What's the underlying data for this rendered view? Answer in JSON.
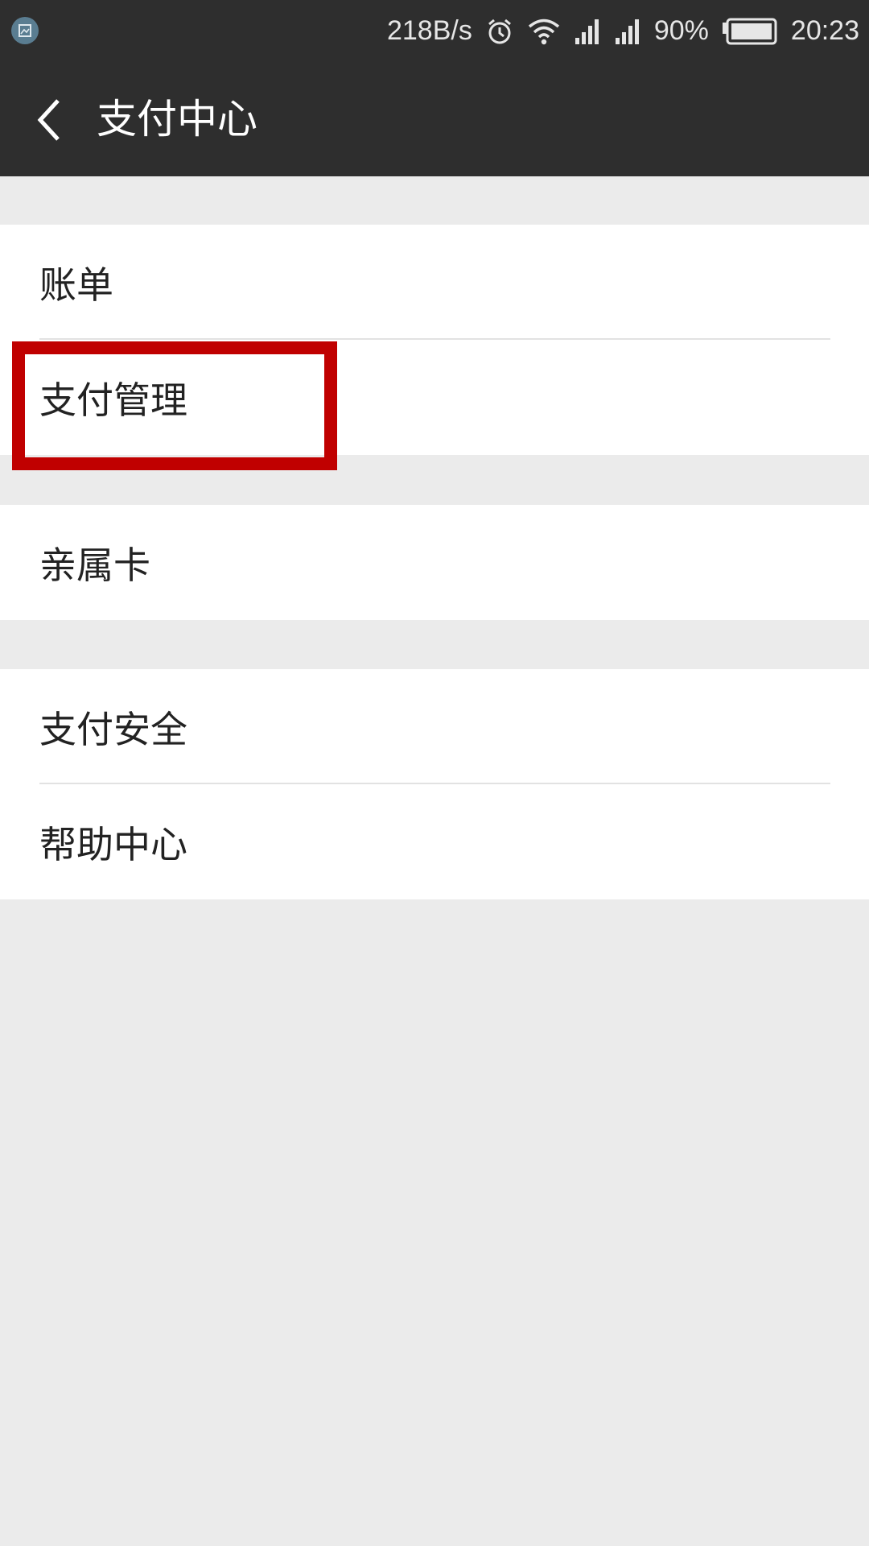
{
  "status_bar": {
    "net_speed": "218B/s",
    "battery_percent": "90%",
    "time": "20:23",
    "icons": [
      "screenshot-icon",
      "alarm-icon",
      "wifi-icon",
      "signal-icon",
      "battery-icon"
    ]
  },
  "toolbar": {
    "title": "支付中心",
    "back_icon": "chevron-left-icon"
  },
  "groups": [
    {
      "items": [
        {
          "label": "账单"
        },
        {
          "label": "支付管理"
        }
      ]
    },
    {
      "items": [
        {
          "label": "亲属卡"
        }
      ]
    },
    {
      "items": [
        {
          "label": "支付安全"
        },
        {
          "label": "帮助中心"
        }
      ]
    }
  ],
  "colors": {
    "toolbar_bg": "#2e2e2e",
    "page_bg": "#ebebeb",
    "highlight": "#c00000"
  }
}
